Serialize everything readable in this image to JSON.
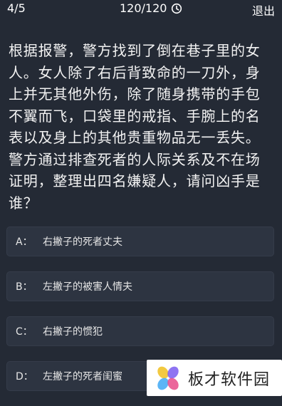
{
  "header": {
    "progress": "4/5",
    "timer": "120/120",
    "timer_icon": "clock-icon",
    "exit_label": "退出"
  },
  "question": {
    "text": "根据报警，警方找到了倒在巷子里的女人。女人除了右后背致命的一刀外，身上并无其他外伤，除了随身携带的手包不翼而飞，口袋里的戒指、手腕上的名表以及身上的其他贵重物品无一丢失。警方通过排查死者的人际关系及不在场证明，整理出四名嫌疑人，请问凶手是谁？"
  },
  "options": [
    {
      "key": "A：",
      "text": "右撇子的死者丈夫"
    },
    {
      "key": "B：",
      "text": "左撇子的被害人情夫"
    },
    {
      "key": "C：",
      "text": "右撇子的惯犯"
    },
    {
      "key": "D：",
      "text": "左撇子的死者闺蜜"
    }
  ],
  "watermark": {
    "text": "板才软件园",
    "logo_colors": [
      "#f0c020",
      "#7a5cf0",
      "#3ea8f5",
      "#e84b8a"
    ]
  }
}
